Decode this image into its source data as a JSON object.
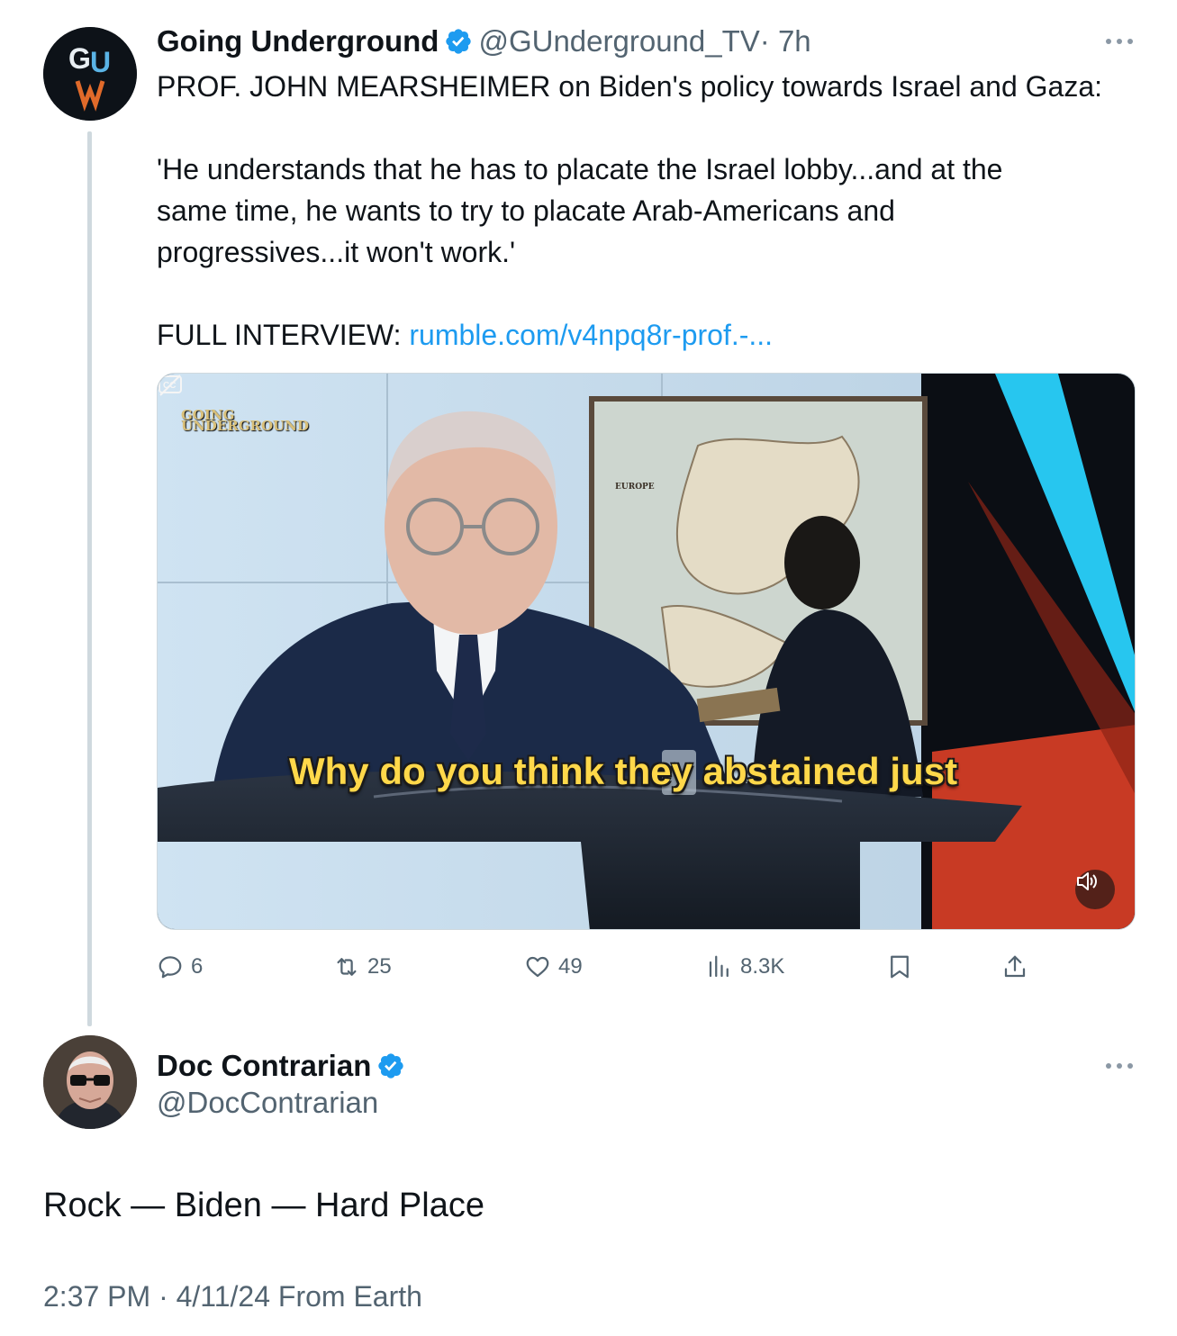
{
  "colors": {
    "accent": "#1d9bf0",
    "text": "#0f1419",
    "muted": "#536471",
    "subtitle": "#ffd84a"
  },
  "original_tweet": {
    "author": {
      "display_name": "Going Underground",
      "handle": "@GUnderground_TV",
      "time": "· 7h",
      "avatar_text": "GU",
      "verified_icon": "verified-badge-icon"
    },
    "text": {
      "line1": "PROF. JOHN MEARSHEIMER on Biden's policy towards Israel and Gaza:",
      "quote_line1": "'He understands that he has to placate the Israel lobby...and at the",
      "quote_line2": "same time, he wants to try to placate Arab-Americans and",
      "quote_line3": "progressives...it won't work.'",
      "interview_label": "FULL INTERVIEW:",
      "interview_link": "rumble.com/v4npq8r-prof.-..."
    },
    "media": {
      "subtitle": "Why do you think they abstained just",
      "logo_line1": "GOING",
      "logo_line2": "UNDERGROUND",
      "map_label": "EUROPE",
      "cc_icon": "closed-captions-icon",
      "mute_icon": "speaker-muted-icon"
    },
    "actions": {
      "replies": "6",
      "reposts": "25",
      "likes": "49",
      "views": "8.3K"
    }
  },
  "reply_tweet": {
    "author": {
      "display_name": "Doc Contrarian",
      "handle": "@DocContrarian",
      "verified_icon": "verified-badge-icon"
    },
    "text": "Rock — Biden — Hard Place",
    "timestamp": "2:37 PM · 4/11/24 From Earth"
  }
}
